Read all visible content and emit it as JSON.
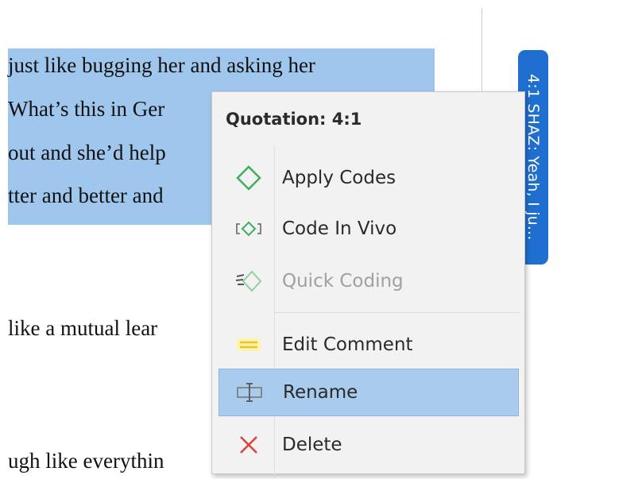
{
  "document": {
    "lines": [
      "just like bugging her and asking her",
      "What’s this in Ger",
      "out and she’d help",
      "tter and better and",
      "like a mutual lear",
      "ugh like everythin"
    ]
  },
  "quote_tab": {
    "label": "4:1 SHAZ: Yeah, I ju..."
  },
  "context_menu": {
    "title": "Quotation: 4:1",
    "items": [
      {
        "label": "Apply Codes",
        "icon": "apply-codes-icon",
        "enabled": true,
        "selected": false
      },
      {
        "label": "Code In Vivo",
        "icon": "code-in-vivo-icon",
        "enabled": true,
        "selected": false
      },
      {
        "label": "Quick Coding",
        "icon": "quick-coding-icon",
        "enabled": false,
        "selected": false
      },
      {
        "label": "Edit Comment",
        "icon": "edit-comment-icon",
        "enabled": true,
        "selected": false
      },
      {
        "label": "Rename",
        "icon": "rename-icon",
        "enabled": true,
        "selected": true
      },
      {
        "label": "Delete",
        "icon": "delete-icon",
        "enabled": true,
        "selected": false
      }
    ]
  },
  "colors": {
    "highlight": "#9fc6ec",
    "quote_tab": "#1f6fd1",
    "selected_item": "#a9cbee",
    "code_green": "#3fae5a",
    "delete_red": "#e0403a",
    "comment_yellow": "#f0c020"
  }
}
